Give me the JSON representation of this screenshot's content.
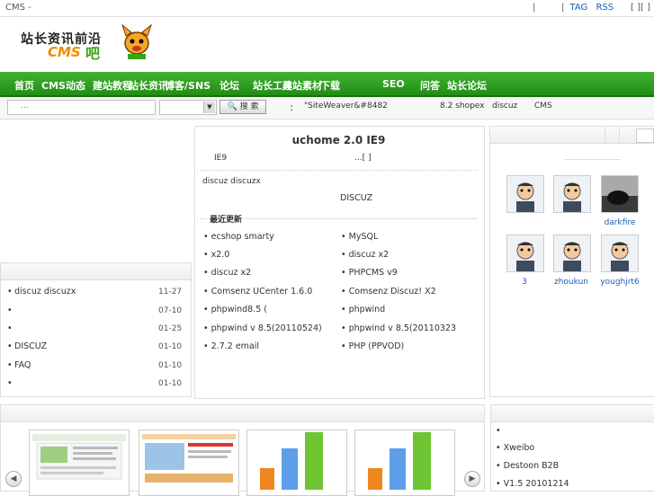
{
  "topbar": {
    "left_text": "CMS -",
    "sep1": "|",
    "sep2": "|",
    "tag": "TAG",
    "rss": "RSS",
    "bracket": "[   ][   ]"
  },
  "logo": {
    "cn": "站长资讯前沿",
    "cms": "CMS",
    "ba": "吧"
  },
  "nav": {
    "items": [
      "首页",
      "CMS动态",
      "建站教程",
      "站长资讯",
      "博客/SNS",
      "论坛",
      "站长工具",
      "建站素材",
      "下载",
      "SEO",
      "问答",
      "站长论坛"
    ]
  },
  "search": {
    "input_placeholder": "...",
    "button_label": "🔍 搜 索",
    "hot_prefix": "：",
    "hot_links": [
      "\"SiteWeaver&#8482",
      "8.2 shopex",
      "discuz",
      "CMS"
    ]
  },
  "headline": {
    "title": "uchome 2.0  IE9",
    "sub_left": "IE9",
    "sub_right": "...[   ]",
    "line2_left": "discuz discuzx",
    "line2_right": "DISCUZ",
    "latest_label": "最近更新"
  },
  "latest_left": [
    "ecshop        smarty",
    "x2.0",
    "discuz x2",
    "Comsenz      UCenter 1.6.0",
    "phpwind8.5          (",
    "phpwind v 8.5(20110524)",
    "  2.7.2          email"
  ],
  "latest_right": [
    "     MySQL",
    "discuz x2",
    "PHPCMS v9",
    "Comsenz       Discuz! X2",
    "phpwind",
    "phpwind v 8.5(20110323",
    "  PHP     (PPVOD)"
  ],
  "left_list": [
    {
      "title": "discuz discuzx",
      "date": "11-27"
    },
    {
      "title": "",
      "date": "07-10"
    },
    {
      "title": "",
      "date": "01-25"
    },
    {
      "title": "DISCUZ",
      "date": "01-10"
    },
    {
      "title": "      FAQ",
      "date": "01-10"
    },
    {
      "title": "",
      "date": "01-10"
    }
  ],
  "users": [
    "darkfire",
    "3",
    "zhoukun",
    "youghjrt6"
  ],
  "right_list": [
    "",
    "Xweibo",
    "Destoon B2B",
    "     V1.5        20101214"
  ],
  "carousel": {
    "prev": "◀",
    "next": "▶"
  },
  "colors": {
    "nav_green": "#2a9d1c",
    "link_blue": "#1a5fb4",
    "bar_orange": "#f0861e",
    "bar_blue": "#5e9de8",
    "bar_green": "#6cc531"
  }
}
